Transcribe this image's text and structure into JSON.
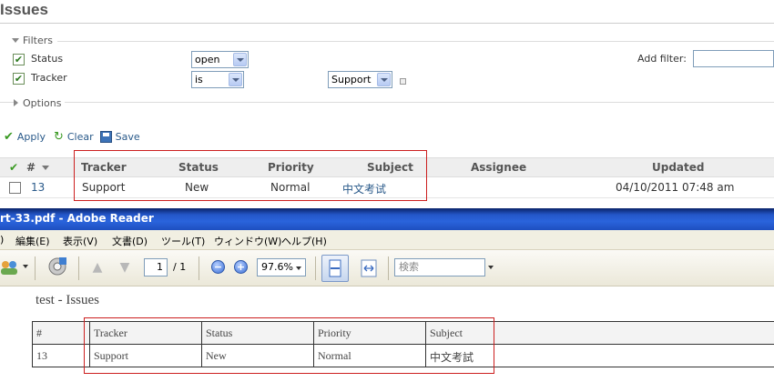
{
  "redmine": {
    "title": "Issues",
    "filters": {
      "legend": "Filters",
      "status": {
        "label": "Status",
        "operator": "open"
      },
      "tracker": {
        "label": "Tracker",
        "operator": "is",
        "value": "Support"
      },
      "add_filter_label": "Add filter:"
    },
    "options_legend": "Options",
    "actions": {
      "apply": "Apply",
      "clear": "Clear",
      "save": "Save"
    },
    "table": {
      "headers": {
        "number": "#",
        "tracker": "Tracker",
        "status": "Status",
        "priority": "Priority",
        "subject": "Subject",
        "assignee": "Assignee",
        "updated": "Updated"
      },
      "rows": [
        {
          "number": "13",
          "tracker": "Support",
          "status": "New",
          "priority": "Normal",
          "subject": "中文考试",
          "assignee": "",
          "updated": "04/10/2011 07:48 am"
        }
      ]
    }
  },
  "reader": {
    "window_title": "rt-33.pdf - Adobe Reader",
    "menu": [
      ")",
      "編集(E)",
      "表示(V)",
      "文書(D)",
      "ツール(T)",
      "ウィンドウ(W)",
      "ヘルプ(H)"
    ],
    "toolbar": {
      "page_current": "1",
      "page_total": "/ 1",
      "zoom": "97.6%",
      "search_placeholder": "検索"
    },
    "document": {
      "title": "test - Issues",
      "headers": [
        "#",
        "Tracker",
        "Status",
        "Priority",
        "Subject"
      ],
      "rows": [
        [
          "13",
          "Support",
          "New",
          "Normal",
          "中文考試"
        ]
      ]
    }
  },
  "colors": {
    "highlight_box": "#cc1f1f",
    "link": "#2a5a8a",
    "titlebar": "#2a64dc"
  }
}
